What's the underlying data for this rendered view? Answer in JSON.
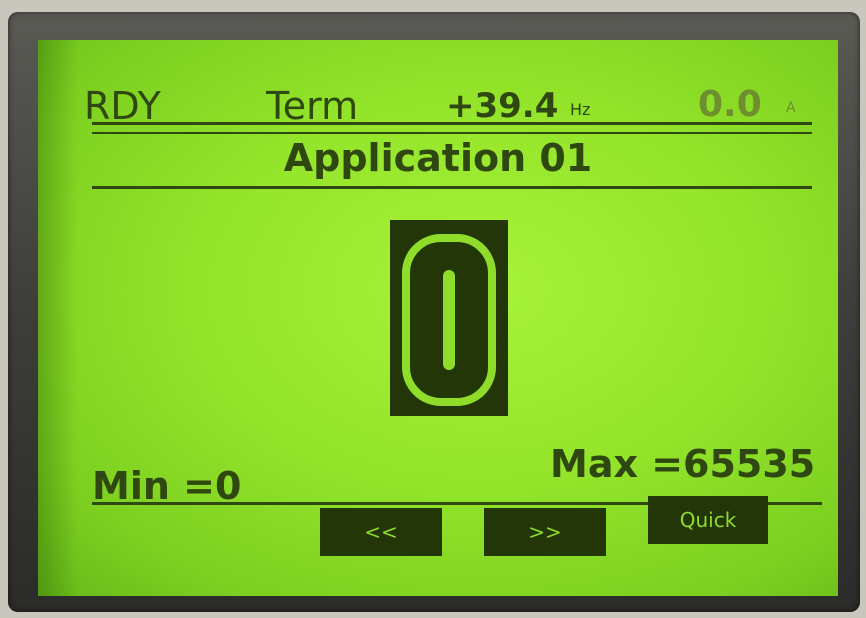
{
  "status": {
    "state": "RDY",
    "mode": "Term",
    "frequency": "+39.4",
    "frequency_unit": "Hz",
    "current": "0.0",
    "current_unit": "A"
  },
  "title": "Application 01",
  "value": {
    "current": "0",
    "min_label": "Min =0",
    "max_label": "Max =65535"
  },
  "softkeys": {
    "back": "<<",
    "forward": ">>",
    "quick": "Quick"
  },
  "colors": {
    "lcd_background": "#93e42a",
    "lcd_ink": "#2f4710"
  }
}
